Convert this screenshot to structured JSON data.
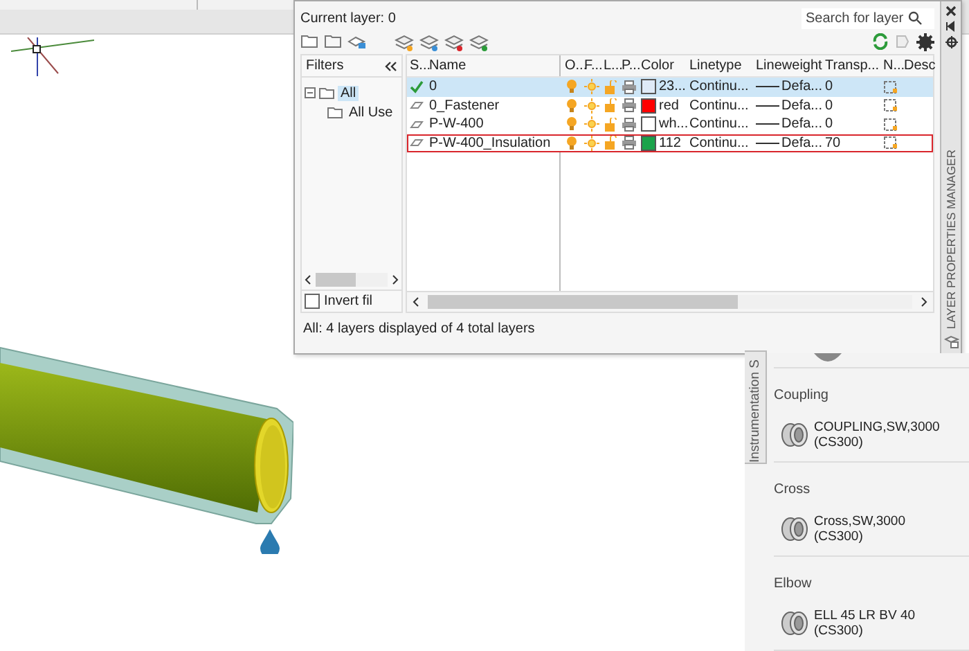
{
  "layer_manager": {
    "title": "LAYER PROPERTIES MANAGER",
    "current_layer": "Current layer: 0",
    "search": {
      "placeholder": "Search for layer"
    },
    "filters": {
      "heading": "Filters",
      "tree": [
        {
          "label": "All",
          "selected": true,
          "expanded": true,
          "children": [
            {
              "label": "All Use",
              "selected": false
            }
          ]
        }
      ],
      "invert": {
        "label": "Invert fil",
        "checked": false
      }
    },
    "columns": [
      "S...",
      "Name",
      "O...",
      "F...",
      "L...",
      "P...",
      "Color",
      "Linetype",
      "Lineweight",
      "Transp...",
      "N...",
      "Desc"
    ],
    "rows": [
      {
        "current": true,
        "selected": true,
        "outlined": false,
        "name": "0",
        "color_name": "23...",
        "color": "#dfeaf7",
        "linetype": "Continu...",
        "lineweight": "Defa...",
        "transparency": "0"
      },
      {
        "current": false,
        "selected": false,
        "outlined": false,
        "name": "0_Fastener",
        "color_name": "red",
        "color": "#ff0000",
        "linetype": "Continu...",
        "lineweight": "Defa...",
        "transparency": "0"
      },
      {
        "current": false,
        "selected": false,
        "outlined": false,
        "name": "P-W-400",
        "color_name": "wh...",
        "color": "#ffffff",
        "linetype": "Continu...",
        "lineweight": "Defa...",
        "transparency": "0"
      },
      {
        "current": false,
        "selected": false,
        "outlined": true,
        "name": "P-W-400_Insulation",
        "color_name": "112",
        "color": "#1aa34a",
        "linetype": "Continu...",
        "lineweight": "Defa...",
        "transparency": "70"
      }
    ],
    "status": "All: 4 layers displayed of 4 total layers"
  },
  "palette": {
    "tab": "Instrumentation S",
    "sections": [
      {
        "heading": "Coupling",
        "items": [
          "COUPLING,SW,3000 (CS300)"
        ]
      },
      {
        "heading": "Cross",
        "items": [
          "Cross,SW,3000 (CS300)"
        ]
      },
      {
        "heading": "Elbow",
        "items": [
          "ELL 45 LR BV 40 (CS300)"
        ]
      }
    ]
  }
}
